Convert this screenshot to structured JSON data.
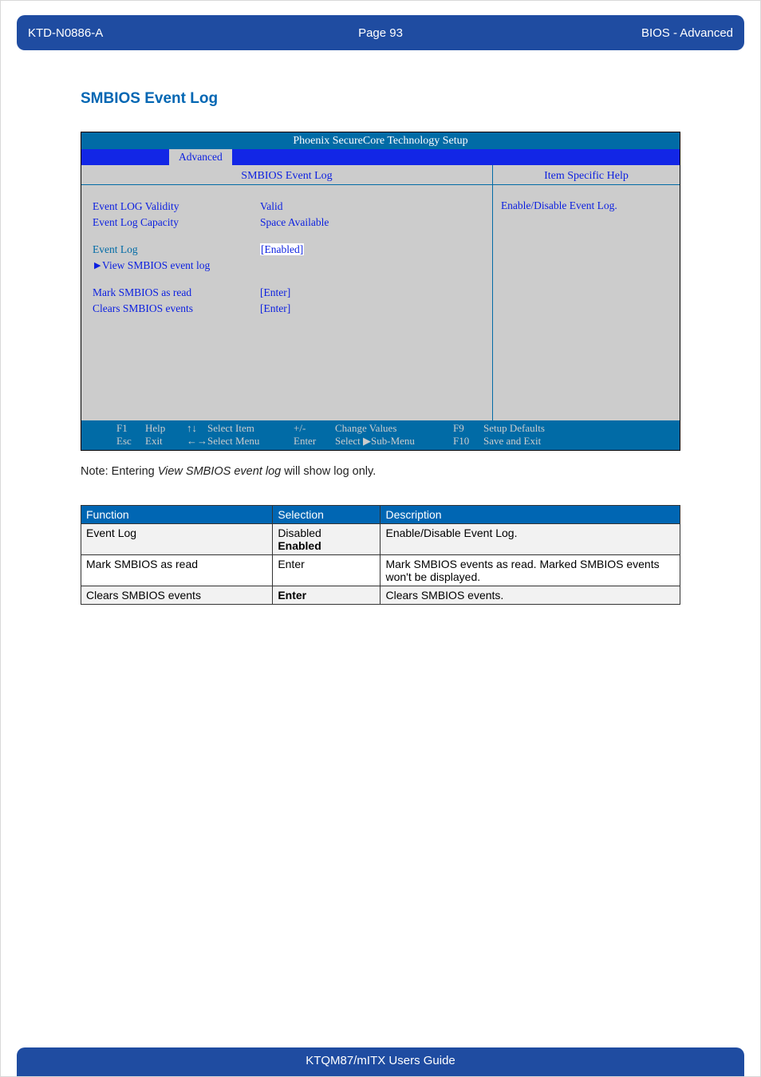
{
  "header": {
    "doc_id": "KTD-N0886-A",
    "page_label": "Page 93",
    "section": "BIOS  - Advanced"
  },
  "title": "SMBIOS Event Log",
  "bios": {
    "window_title": "Phoenix SecureCore Technology Setup",
    "tab": "Advanced",
    "left_title": "SMBIOS Event Log",
    "right_title": "Item Specific Help",
    "help_text": "Enable/Disable Event Log.",
    "rows": {
      "validity_label": "Event LOG Validity",
      "validity_value": "Valid",
      "capacity_label": "Event Log Capacity",
      "capacity_value": "Space Available",
      "eventlog_label": "Event Log",
      "eventlog_value": "[Enabled]",
      "view_label": "View SMBIOS event log",
      "mark_label": "Mark SMBIOS as read",
      "mark_value": "[Enter]",
      "clear_label": "Clears SMBIOS events",
      "clear_value": "[Enter]"
    },
    "footer": {
      "f1_k": "F1",
      "f1_l": "Help",
      "ud_k": "↑↓",
      "ud_l": "Select Item",
      "pm_k": "+/-",
      "pm_l": "Change Values",
      "f9_k": "F9",
      "f9_l": "Setup Defaults",
      "esc_k": "Esc",
      "esc_l": "Exit",
      "lr_k": "←→",
      "lr_l": "Select Menu",
      "en_k": "Enter",
      "en_l": "Select ▶Sub-Menu",
      "f10_k": "F10",
      "f10_l": "Save and Exit"
    }
  },
  "note_prefix": "Note: Entering ",
  "note_italic": "View SMBIOS event log",
  "note_suffix": " will show log only.",
  "table": {
    "headers": {
      "c1": "Function",
      "c2": "Selection",
      "c3": "Description"
    },
    "r1": {
      "func": "Event Log",
      "sel_a": "Disabled",
      "sel_b": "Enabled",
      "desc": "Enable/Disable Event Log."
    },
    "r2": {
      "func": "Mark SMBIOS as read",
      "sel": "Enter",
      "desc": "Mark SMBIOS events as read. Marked SMBIOS events won't be displayed."
    },
    "r3": {
      "func": "Clears SMBIOS events",
      "sel": "Enter",
      "desc": "Clears SMBIOS events."
    }
  },
  "footer_text": "KTQM87/mITX Users Guide",
  "chart_data": {
    "type": "table",
    "title": "SMBIOS Event Log options",
    "columns": [
      "Function",
      "Selection",
      "Description"
    ],
    "rows": [
      [
        "Event Log",
        "Disabled / Enabled",
        "Enable/Disable Event Log."
      ],
      [
        "Mark SMBIOS as read",
        "Enter",
        "Mark SMBIOS events as read. Marked SMBIOS events won't be displayed."
      ],
      [
        "Clears SMBIOS events",
        "Enter",
        "Clears SMBIOS events."
      ]
    ]
  }
}
